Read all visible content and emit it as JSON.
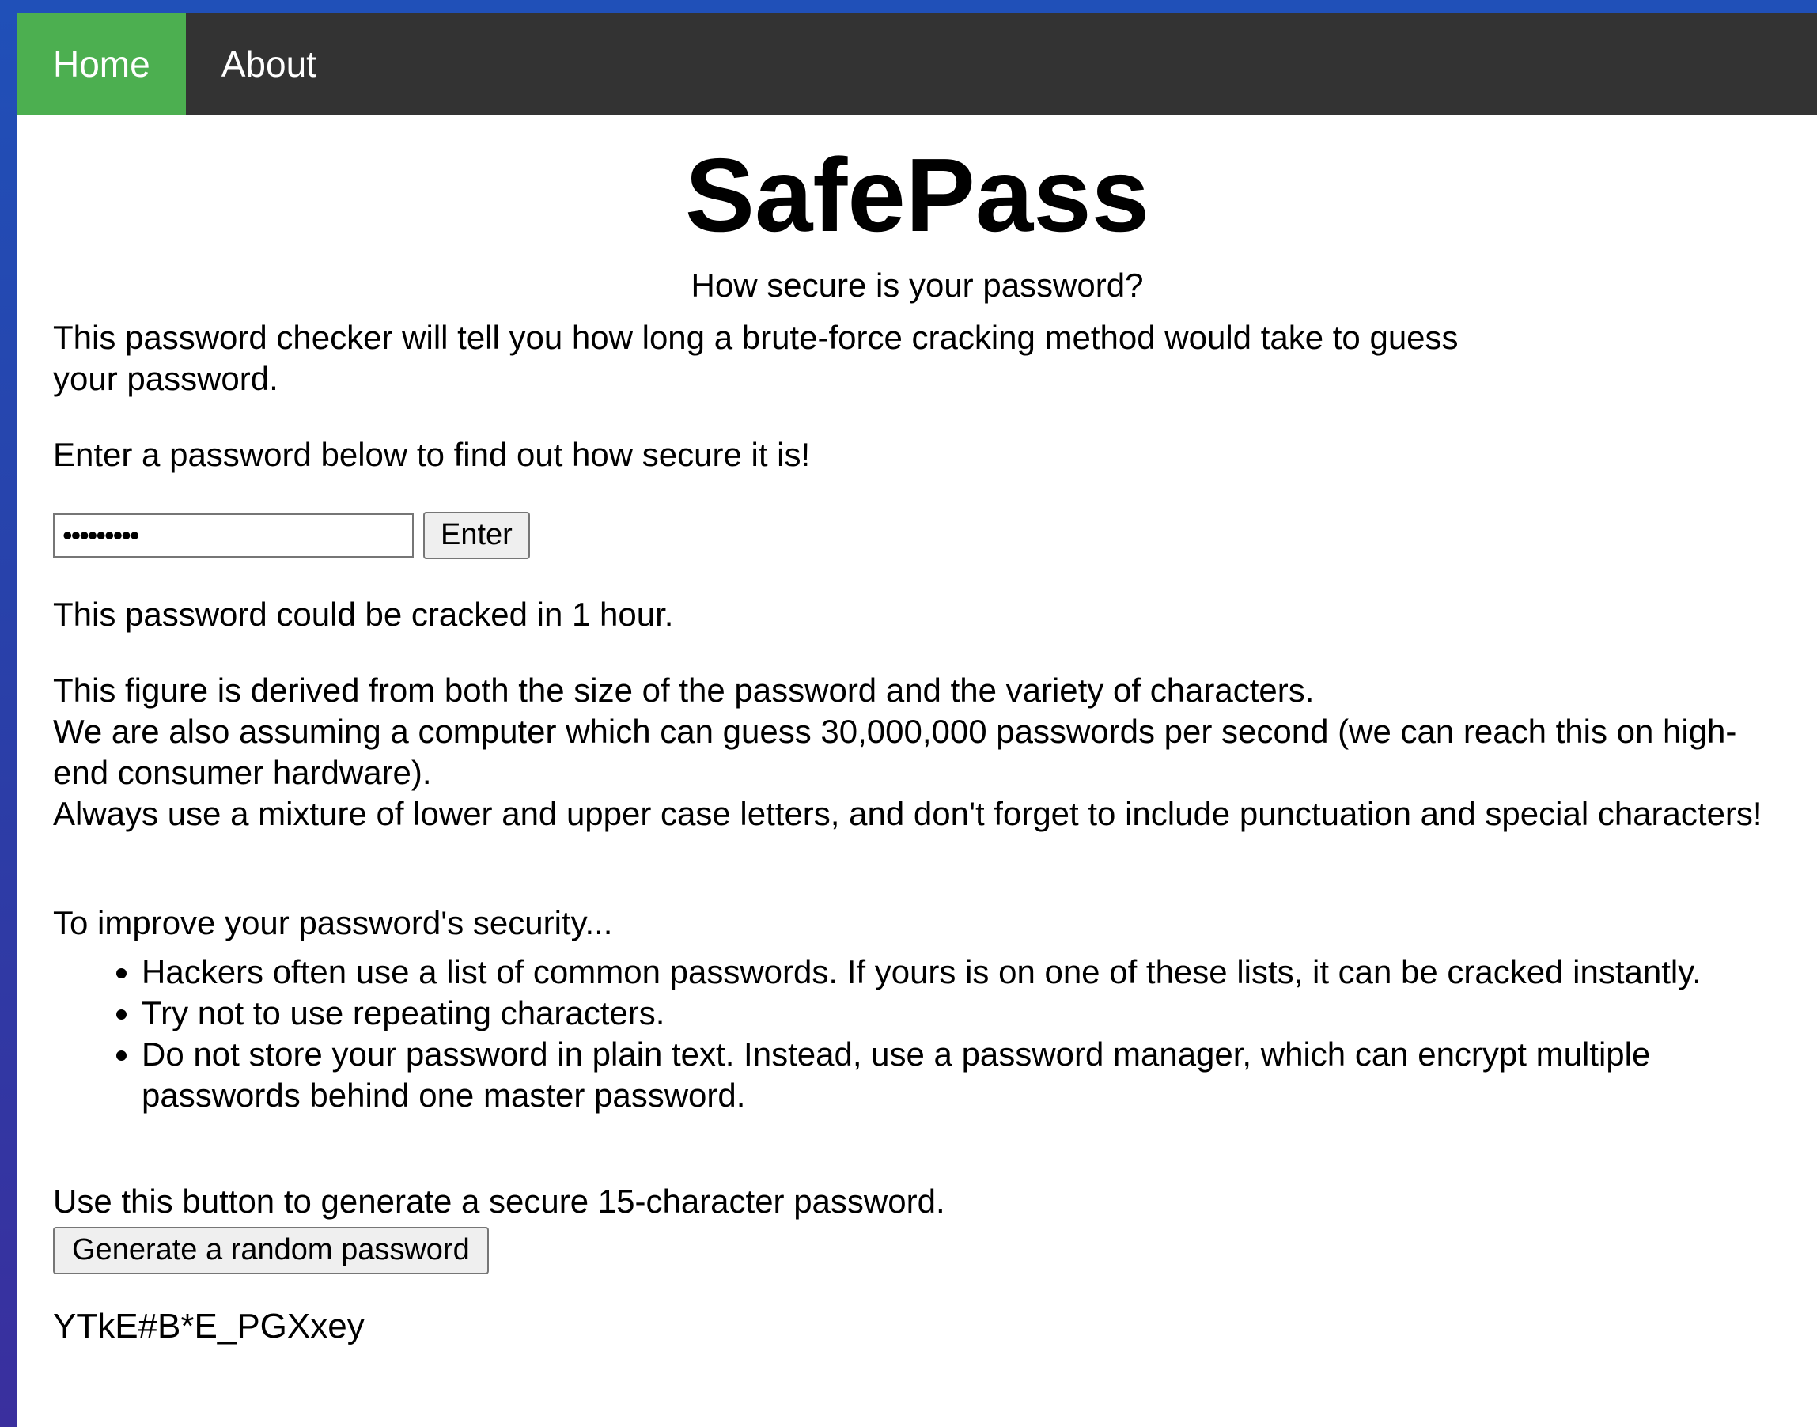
{
  "nav": {
    "home": "Home",
    "about": "About",
    "active_color": "#4caf50",
    "bar_color": "#333333"
  },
  "main": {
    "title": "SafePass",
    "subtitle": "How secure is your password?",
    "intro": "This password checker will tell you how long a brute-force cracking method would take to guess your password.",
    "prompt": "Enter a password below to find out how secure it is!",
    "password_value": "•••••••••",
    "enter_label": "Enter",
    "result": "This password could be cracked in 1 hour.",
    "explain_1": "This figure is derived from both the size of the password and the variety of characters.",
    "explain_2": "We are also assuming a computer which can guess 30,000,000 passwords per second (we can reach this on high-end consumer hardware).",
    "explain_3": "Always use a mixture of lower and upper case letters, and don't forget to include punctuation and special characters!",
    "improve_heading": "To improve your password's security...",
    "tips": [
      "Hackers often use a list of common passwords. If yours is on one of these lists, it can be cracked instantly.",
      "Try not to use repeating characters.",
      "Do not store your password in plain text. Instead, use a password manager, which can encrypt multiple passwords behind one master password."
    ],
    "generate_text": "Use this button to generate a secure 15-character password.",
    "generate_label": "Generate a random password",
    "generated_password": "YTkE#B*E_PGXxey"
  }
}
